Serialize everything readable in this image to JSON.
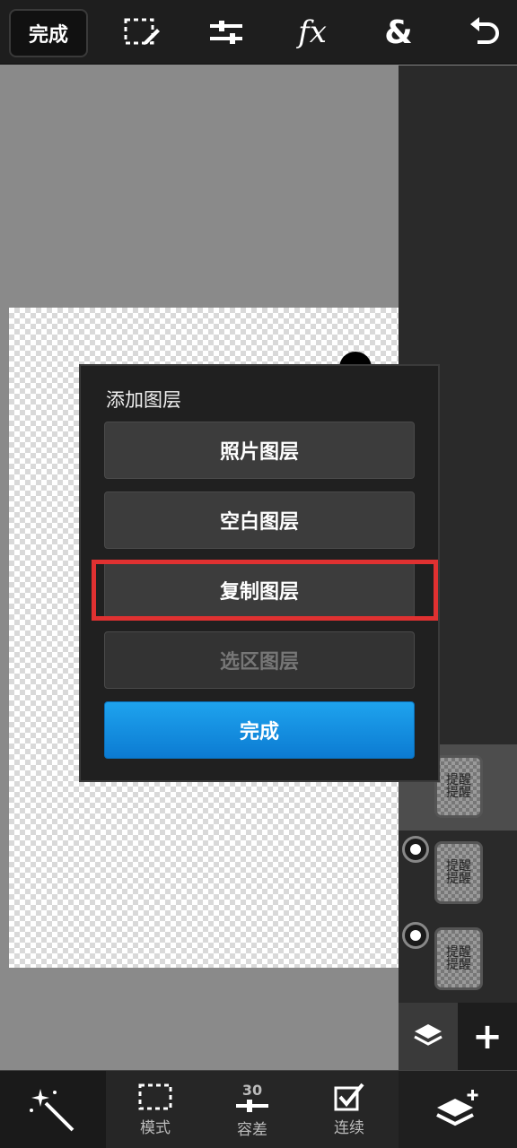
{
  "topbar": {
    "done_label": "完成",
    "fx_label": "fx",
    "amp_label": "&",
    "icons": [
      "selection-edit-icon",
      "adjust-sliders-icon",
      "fx-icon",
      "blend-icon",
      "undo-icon"
    ]
  },
  "dialog": {
    "title": "添加图层",
    "options": [
      {
        "label": "照片图层",
        "state": "enabled"
      },
      {
        "label": "空白图层",
        "state": "enabled"
      },
      {
        "label": "复制图层",
        "state": "enabled",
        "highlighted": true
      },
      {
        "label": "选区图层",
        "state": "disabled"
      }
    ],
    "done_label": "完成"
  },
  "layers": {
    "items": [
      {
        "selected": true,
        "visible_radio": false,
        "thumb_text": "提醒\n提醒"
      },
      {
        "selected": false,
        "visible_radio": true,
        "thumb_text": "提醒\n提醒"
      },
      {
        "selected": false,
        "visible_radio": true,
        "thumb_text": "提醒\n提醒"
      }
    ],
    "add_label": "+"
  },
  "bottom": {
    "mode_label": "模式",
    "tolerance_value": "30",
    "tolerance_label": "容差",
    "contiguous_label": "连续"
  },
  "colors": {
    "accent": "#1496e6",
    "highlight": "#e03131",
    "panel": "#2a2a2a"
  }
}
